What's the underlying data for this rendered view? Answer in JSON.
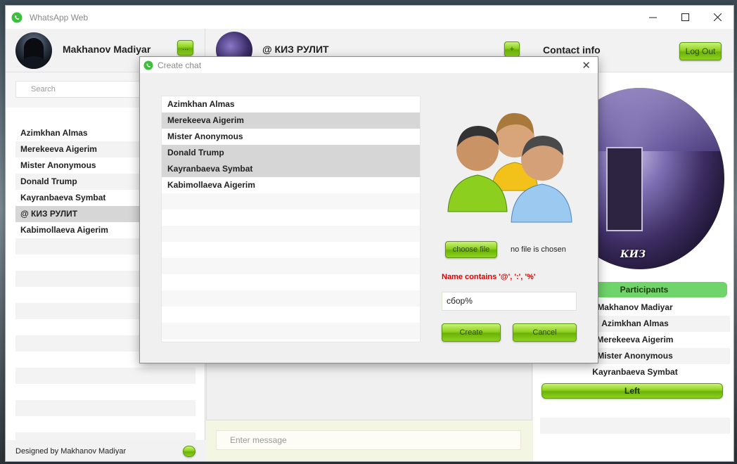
{
  "window": {
    "title": "WhatsApp Web"
  },
  "user": {
    "name": "Makhanov Madiyar",
    "menu_label": "..."
  },
  "search": {
    "placeholder": "Search"
  },
  "contacts": [
    "Azimkhan Almas",
    "Merekeeva Aigerim",
    "Mister Anonymous",
    "Donald Trump",
    "Kayranbaeva Symbat",
    "@ КИЗ РУЛИТ",
    "Kabimollaeva Aigerim"
  ],
  "selected_contact_index": 5,
  "footer": {
    "credit": "Designed by Makhanov Madiyar"
  },
  "chat": {
    "name": "@ КИЗ РУЛИТ",
    "add_label": "+",
    "message_placeholder": "Enter message"
  },
  "contact_info": {
    "title": "Contact info",
    "logout_label": "Log Out",
    "photo_caption": "КИЗ",
    "participants_header": "Participants",
    "participants": [
      "Makhanov Madiyar",
      "Azimkhan Almas",
      "Merekeeva Aigerim",
      "Mister Anonymous",
      "Kayranbaeva Symbat"
    ],
    "left_label": "Left"
  },
  "dialog": {
    "title": "Create chat",
    "close_glyph": "✕",
    "contacts": [
      "Azimkhan Almas",
      "Merekeeva Aigerim",
      "Mister Anonymous",
      "Donald Trump",
      "Kayranbaeva Symbat",
      "Kabimollaeva Aigerim"
    ],
    "selected_indices": [
      1,
      3,
      4
    ],
    "choose_file_label": "choose file",
    "no_file_text": "no file is chosen",
    "error_text": "Name contains '@', ':', '%'",
    "name_value": "сбор%",
    "create_label": "Create",
    "cancel_label": "Cancel"
  },
  "colors": {
    "accent_green": "#8fd11c",
    "error": "#e00000",
    "participants_header": "#6fd46a"
  }
}
